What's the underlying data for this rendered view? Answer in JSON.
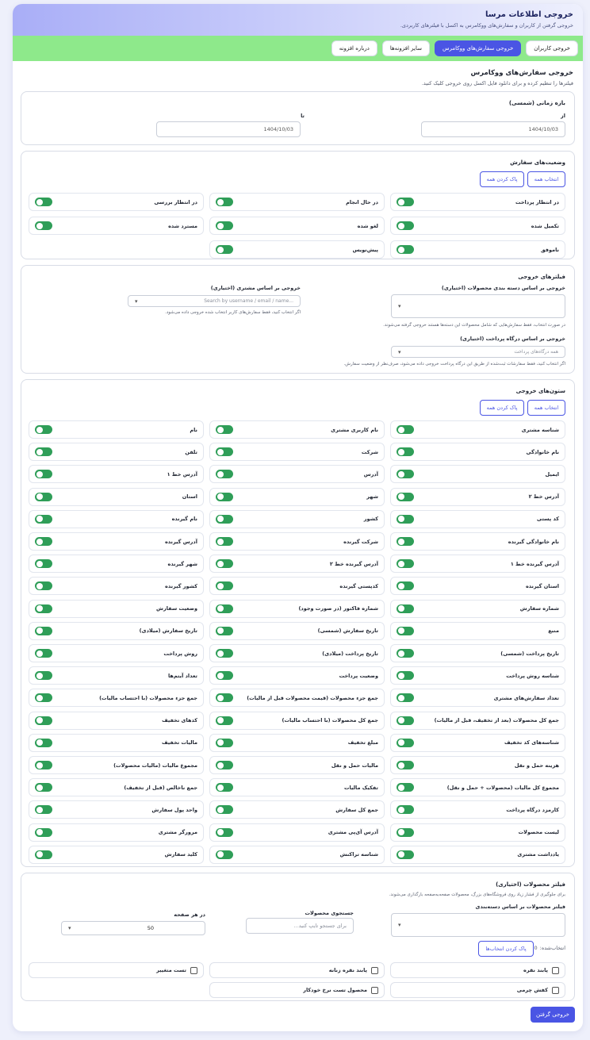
{
  "header": {
    "title": "خروجی اطلاعات مرسا",
    "subtitle": "خروجی گرفتن از کاربران و سفارش‌های ووکامرس به اکسل با فیلترهای کاربردی."
  },
  "tabs": [
    {
      "label": "خروجی کاربران",
      "active": false
    },
    {
      "label": "خروجی سفارش‌های ووکامرس",
      "active": true
    },
    {
      "label": "سایر افزونه‌ها",
      "active": false
    },
    {
      "label": "درباره افزونه",
      "active": false
    }
  ],
  "page": {
    "title": "خروجی سفارش‌های ووکامرس",
    "subtitle": "فیلترها را تنظیم کرده و برای دانلود فایل اکسل روی خروجی کلیک کنید."
  },
  "date_range": {
    "title": "بازه زمانی (شمسی)",
    "from_label": "از",
    "from_value": "1404/10/03",
    "to_label": "تا",
    "to_value": "1404/10/03"
  },
  "order_status": {
    "title": "وضعیت‌های سفارش",
    "select_all": "انتخاب همه",
    "clear_all": "پاک کردن همه",
    "items": [
      "در انتظار پرداخت",
      "در حال انجام",
      "در انتظار بررسی",
      "تکمیل شده",
      "لغو شده",
      "مسترد شده",
      "ناموفق",
      "پیش‌نویس"
    ]
  },
  "export_filters": {
    "title": "فیلترهای خروجی",
    "category_label": "خروجی بر اساس دسته بندی محصولات (اختیاری)",
    "category_hint": "در صورت انتخاب، فقط سفارش‌هایی که شامل محصولات این دسته‌ها هستند خروجی گرفته می‌شوند.",
    "customer_label": "خروجی بر اساس مشتری (اختیاری)",
    "customer_placeholder": "Search by username / email / name...",
    "customer_hint": "اگر انتخاب کنید، فقط سفارش‌های کاربر انتخاب شده خروجی داده می‌شود.",
    "gateway_label": "خروجی بر اساس درگاه پرداخت (اختیاری)",
    "gateway_value": "همه درگاه‌های پرداخت",
    "gateway_hint": "اگر انتخاب کنید، فقط سفارشات ثبت‌شده از طریق این درگاه پرداخت خروجی داده می‌شود، صرف‌نظر از وضعیت سفارش."
  },
  "columns": {
    "title": "ستون‌های خروجی",
    "select_all": "انتخاب همه",
    "clear_all": "پاک کردن همه",
    "items": [
      "شناسه مشتری",
      "نام کاربری مشتری",
      "نام",
      "نام خانوادگی",
      "شرکت",
      "تلفن",
      "ایمیل",
      "آدرس",
      "آدرس خط ۱",
      "آدرس خط ۲",
      "شهر",
      "استان",
      "کد پستی",
      "کشور",
      "نام گیرنده",
      "نام خانوادگی گیرنده",
      "شرکت گیرنده",
      "آدرس گیرنده",
      "آدرس گیرنده خط ۱",
      "آدرس گیرنده خط ۲",
      "شهر گیرنده",
      "استان گیرنده",
      "کدپستی گیرنده",
      "کشور گیرنده",
      "شماره سفارش",
      "شماره فاکتور (در صورت وجود)",
      "وضعیت سفارش",
      "منبع",
      "تاریخ سفارش (شمسی)",
      "تاریخ سفارش (میلادی)",
      "تاریخ پرداخت (شمسی)",
      "تاریخ پرداخت (میلادی)",
      "روش پرداخت",
      "شناسه روش پرداخت",
      "وضعیت پرداخت",
      "تعداد آیتم‌ها",
      "تعداد سفارش‌های مشتری",
      "جمع جزء محصولات (قیمت محصولات قبل از مالیات)",
      "جمع جزء محصولات (با احتساب مالیات)",
      "جمع کل محصولات (بعد از تخفیف، قبل از مالیات)",
      "جمع کل محصولات (با احتساب مالیات)",
      "کدهای تخفیف",
      "شناسه‌های کد تخفیف",
      "مبلغ تخفیف",
      "مالیات تخفیف",
      "هزینه حمل و نقل",
      "مالیات حمل و نقل",
      "مجموع مالیات (مالیات محصولات)",
      "مجموع کل مالیات (محصولات + حمل و نقل)",
      "تفکیک مالیات",
      "جمع ناخالص (قبل از تخفیف)",
      "کارمزد درگاه پرداخت",
      "جمع کل سفارش",
      "واحد پول سفارش",
      "لیست محصولات",
      "آدرس آی‌پی مشتری",
      "مرورگر مشتری",
      "یادداشت مشتری",
      "شناسه تراکنش",
      "کلید سفارش"
    ]
  },
  "product_filter": {
    "title": "فیلتر محصولات (اختیاری)",
    "subtitle": "برای جلوگیری از فشار زیاد روی فروشگاه‌های بزرگ، محصولات صفحه‌به‌صفحه بارگذاری می‌شوند.",
    "category_label": "فیلتر محصولات بر اساس دسته‌بندی",
    "search_label": "جستجوی محصولات",
    "search_placeholder": "برای جستجو تایپ کنید...",
    "per_page_label": "در هر صفحه",
    "per_page_value": "50",
    "selected_label": "انتخاب‌شده:",
    "selected_count": "0",
    "clear_selection": "پاک کردن انتخاب‌ها",
    "products": [
      "پابند نقره",
      "پابند نقره زنانه",
      "تست متغییر",
      "کفش چرمی",
      "محصول تست نرخ خودکار"
    ]
  },
  "export_button": "خروجی گرفتن",
  "colors": {
    "accent": "#4a55e4",
    "toggle_on": "#2f9e58",
    "tabbar": "#8ee98b"
  },
  "icons": {
    "dropdown": "chevron-down-icon"
  }
}
